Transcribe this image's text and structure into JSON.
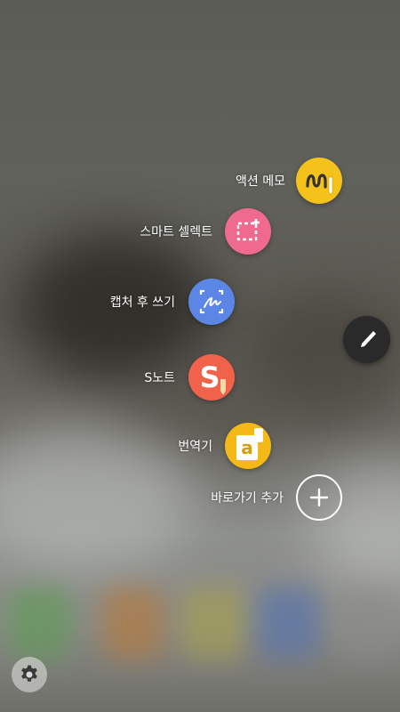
{
  "menu": {
    "items": [
      {
        "label": "액션 메모",
        "icon": "action-memo-icon",
        "color": "#F4C21B"
      },
      {
        "label": "스마트 셀렉트",
        "icon": "smart-select-icon",
        "color": "#F06A8E"
      },
      {
        "label": "캡처 후 쓰기",
        "icon": "screen-write-icon",
        "color": "#5B86E5"
      },
      {
        "label": "S노트",
        "icon": "s-note-icon",
        "color": "#F0624A"
      },
      {
        "label": "번역기",
        "icon": "translate-icon",
        "color": "#F4B917"
      },
      {
        "label": "바로가기 추가",
        "icon": "plus-icon",
        "color": "transparent"
      }
    ]
  },
  "translate_glyph": "a",
  "snote_glyph": "S",
  "pen_button": {
    "icon": "pen-icon",
    "color": "#2A2A2A"
  },
  "settings": {
    "icon": "gear-icon"
  }
}
